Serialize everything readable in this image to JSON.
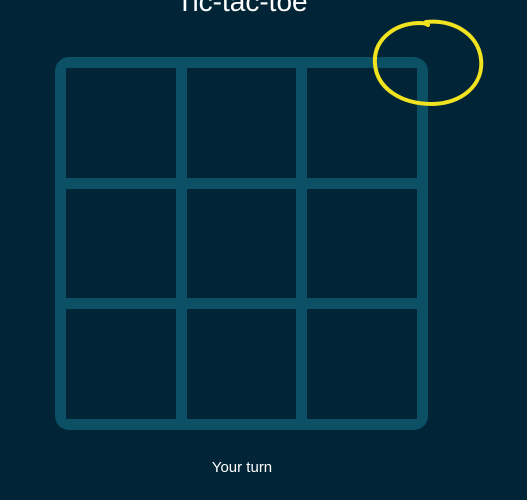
{
  "game": {
    "title": "Tic-tac-toe",
    "status": "Your turn",
    "board": [
      [
        "",
        "",
        ""
      ],
      [
        "",
        "",
        ""
      ],
      [
        "",
        "",
        ""
      ]
    ]
  },
  "colors": {
    "background": "#012437",
    "grid": "#0b5065",
    "text": "#ffffff",
    "annotation": "#f2e320"
  }
}
